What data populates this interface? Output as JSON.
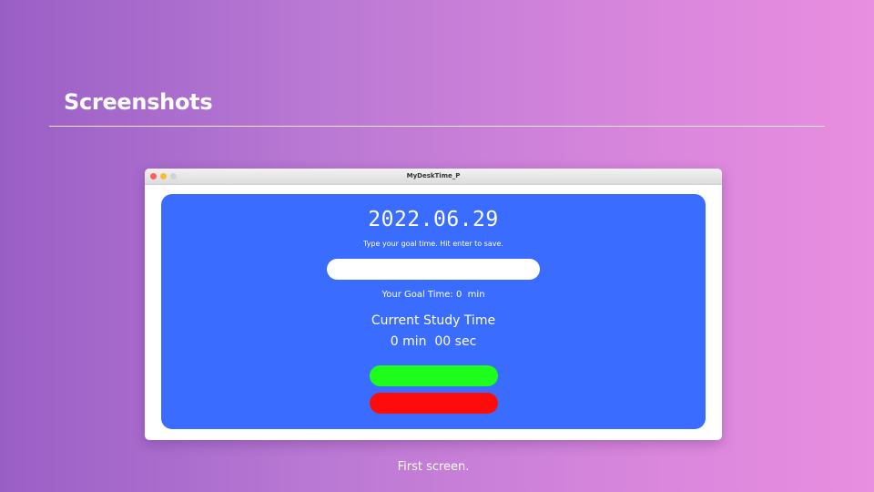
{
  "slide": {
    "title": "Screenshots",
    "caption": "First screen."
  },
  "window": {
    "title": "MyDeskTime_P"
  },
  "app": {
    "date": "2022.06.29",
    "instruction": "Type your goal time. Hit enter to save.",
    "goal_input_value": "",
    "goal_time_text": "Your Goal Time: 0  min",
    "study_label": "Current Study Time",
    "study_time_text": "0 min  00 sec",
    "start_button_color": "#1dfe1d",
    "stop_button_color": "#fe0b0b",
    "panel_color": "#3a6cff"
  },
  "icons": [
    "close-window-icon",
    "minimize-window-icon",
    "zoom-window-icon"
  ]
}
